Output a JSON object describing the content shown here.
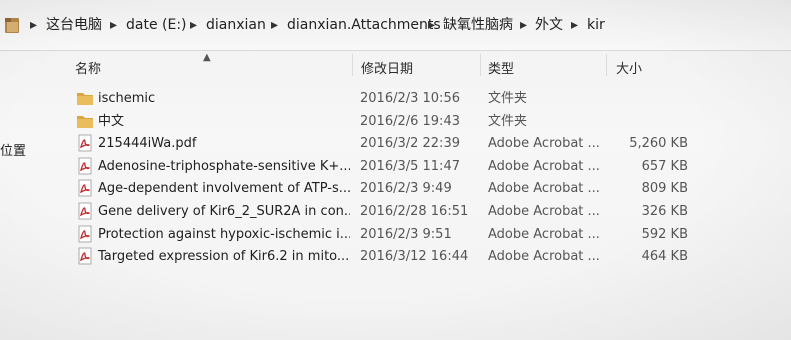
{
  "breadcrumb": {
    "items": [
      "这台电脑",
      "date (E:)",
      "dianxian",
      "dianxian.Attachments",
      "缺氧性脑病",
      "外文",
      "kir"
    ]
  },
  "columns": {
    "name": "名称",
    "date_modified": "修改日期",
    "type": "类型",
    "size": "大小"
  },
  "nav": {
    "location_label": "位置"
  },
  "files": [
    {
      "name": "ischemic",
      "date": "2016/2/3 10:56",
      "type": "文件夹",
      "size": "",
      "icon": "folder-icon"
    },
    {
      "name": "中文",
      "date": "2016/2/6 19:43",
      "type": "文件夹",
      "size": "",
      "icon": "folder-icon"
    },
    {
      "name": "215444iWa.pdf",
      "date": "2016/3/2 22:39",
      "type": "Adobe Acrobat ...",
      "size": "5,260 KB",
      "icon": "pdf-icon"
    },
    {
      "name": "Adenosine-triphosphate-sensitive K+...",
      "date": "2016/3/5 11:47",
      "type": "Adobe Acrobat ...",
      "size": "657 KB",
      "icon": "pdf-icon"
    },
    {
      "name": "Age-dependent involvement of ATP-s...",
      "date": "2016/2/3 9:49",
      "type": "Adobe Acrobat ...",
      "size": "809 KB",
      "icon": "pdf-icon"
    },
    {
      "name": "Gene delivery of Kir6_2_SUR2A in con...",
      "date": "2016/2/28 16:51",
      "type": "Adobe Acrobat ...",
      "size": "326 KB",
      "icon": "pdf-icon"
    },
    {
      "name": "Protection against hypoxic-ischemic i...",
      "date": "2016/2/3 9:51",
      "type": "Adobe Acrobat ...",
      "size": "592 KB",
      "icon": "pdf-icon"
    },
    {
      "name": "Targeted expression of Kir6.2 in mito...",
      "date": "2016/3/12 16:44",
      "type": "Adobe Acrobat ...",
      "size": "464 KB",
      "icon": "pdf-icon"
    }
  ],
  "colors": {
    "folder": "#d9a441",
    "pdf_red": "#c0282d"
  }
}
